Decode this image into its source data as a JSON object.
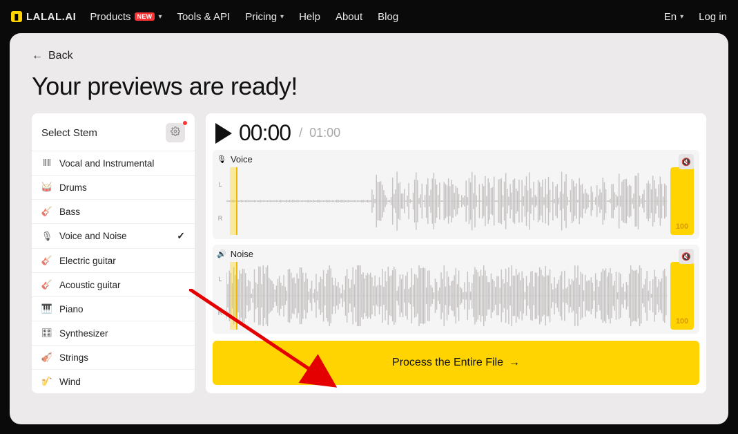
{
  "topbar": {
    "brand": "LALAL.AI",
    "nav": {
      "products": "Products",
      "products_badge": "NEW",
      "tools": "Tools & API",
      "pricing": "Pricing",
      "help": "Help",
      "about": "About",
      "blog": "Blog"
    },
    "lang": "En",
    "login": "Log in"
  },
  "page": {
    "back": "Back",
    "title": "Your previews are ready!"
  },
  "sidebar": {
    "title": "Select Stem",
    "items": [
      {
        "label": "Vocal and Instrumental",
        "selected": false
      },
      {
        "label": "Drums",
        "selected": false
      },
      {
        "label": "Bass",
        "selected": false
      },
      {
        "label": "Voice and Noise",
        "selected": true
      },
      {
        "label": "Electric guitar",
        "selected": false
      },
      {
        "label": "Acoustic guitar",
        "selected": false
      },
      {
        "label": "Piano",
        "selected": false
      },
      {
        "label": "Synthesizer",
        "selected": false
      },
      {
        "label": "Strings",
        "selected": false
      },
      {
        "label": "Wind",
        "selected": false
      }
    ]
  },
  "player": {
    "current": "00:00",
    "total": "01:00"
  },
  "tracks": {
    "voice": {
      "label": "Voice",
      "l": "L",
      "r": "R",
      "volume": "100"
    },
    "noise": {
      "label": "Noise",
      "l": "L",
      "r": "R",
      "volume": "100"
    }
  },
  "cta": {
    "process": "Process the Entire File"
  }
}
